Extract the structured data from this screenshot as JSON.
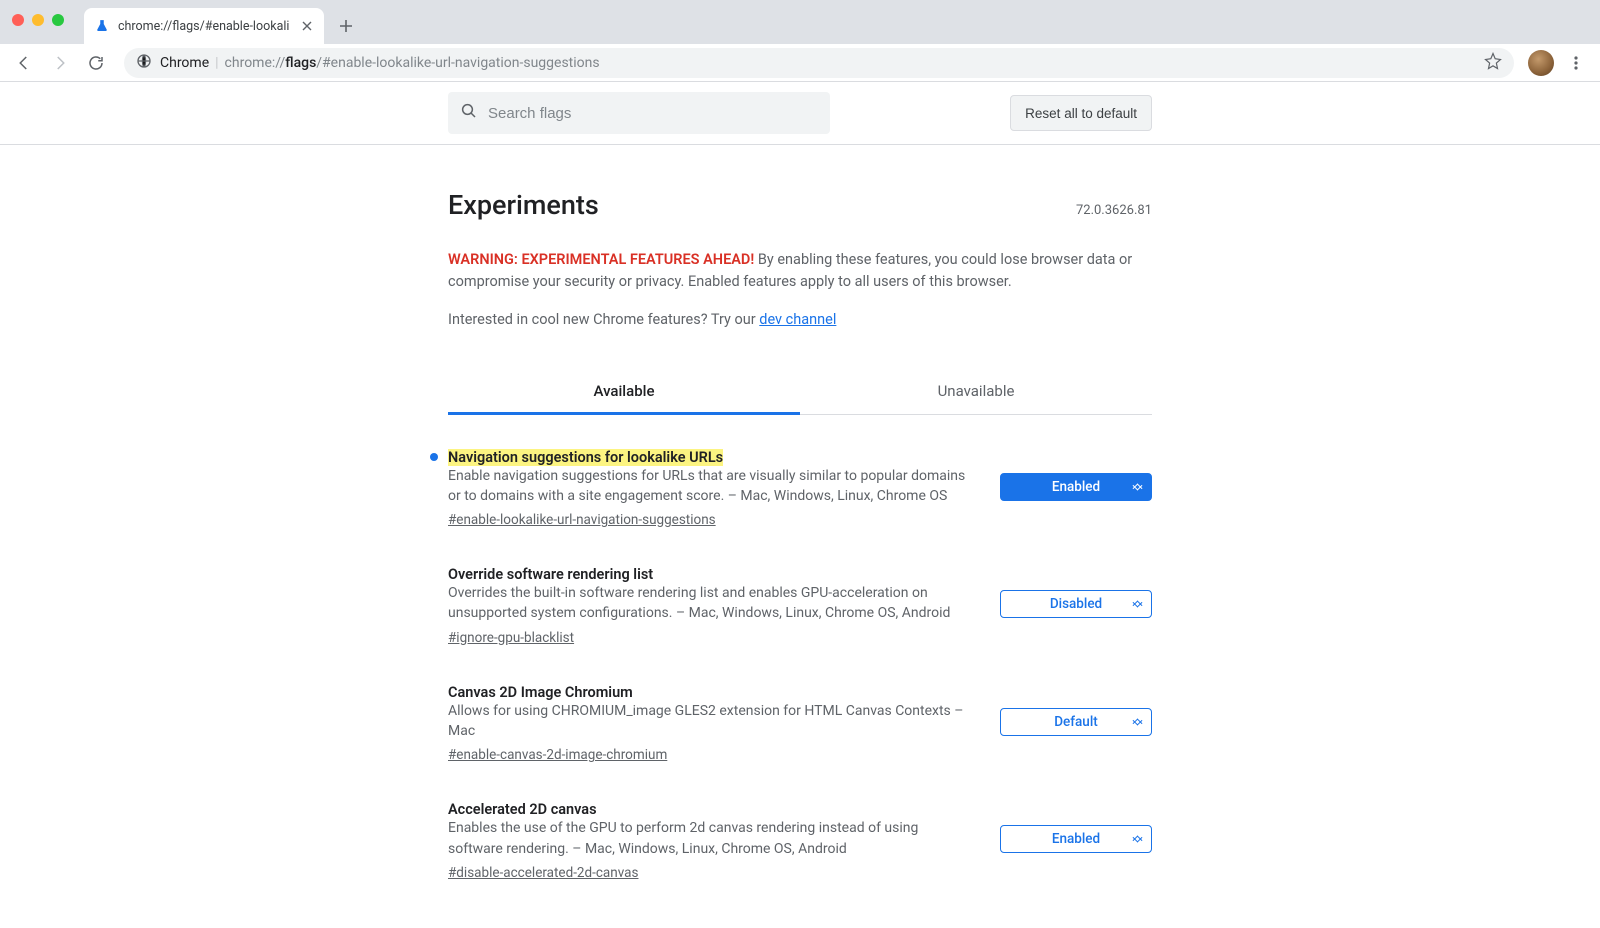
{
  "browser": {
    "tab_title": "chrome://flags/#enable-lookali",
    "url_site_label": "Chrome",
    "url_prefix": "chrome://",
    "url_bold": "flags",
    "url_rest": "/#enable-lookalike-url-navigation-suggestions"
  },
  "topbar": {
    "search_placeholder": "Search flags",
    "reset_label": "Reset all to default"
  },
  "header": {
    "title": "Experiments",
    "version": "72.0.3626.81"
  },
  "warning": {
    "bold": "WARNING: EXPERIMENTAL FEATURES AHEAD!",
    "rest": " By enabling these features, you could lose browser data or compromise your security or privacy. Enabled features apply to all users of this browser."
  },
  "interested": {
    "text": "Interested in cool new Chrome features? Try our ",
    "link": "dev channel"
  },
  "tabs": {
    "available": "Available",
    "unavailable": "Unavailable"
  },
  "flags": [
    {
      "title": "Navigation suggestions for lookalike URLs",
      "highlight": true,
      "modified": true,
      "desc": "Enable navigation suggestions for URLs that are visually similar to popular domains or to domains with a site engagement score. – Mac, Windows, Linux, Chrome OS",
      "anchor": "#enable-lookalike-url-navigation-suggestions",
      "state": "Enabled",
      "solid": true
    },
    {
      "title": "Override software rendering list",
      "highlight": false,
      "modified": false,
      "desc": "Overrides the built-in software rendering list and enables GPU-acceleration on unsupported system configurations. – Mac, Windows, Linux, Chrome OS, Android",
      "anchor": "#ignore-gpu-blacklist",
      "state": "Disabled",
      "solid": false
    },
    {
      "title": "Canvas 2D Image Chromium",
      "highlight": false,
      "modified": false,
      "desc": "Allows for using CHROMIUM_image GLES2 extension for HTML Canvas Contexts – Mac",
      "anchor": "#enable-canvas-2d-image-chromium",
      "state": "Default",
      "solid": false
    },
    {
      "title": "Accelerated 2D canvas",
      "highlight": false,
      "modified": false,
      "desc": "Enables the use of the GPU to perform 2d canvas rendering instead of using software rendering. – Mac, Windows, Linux, Chrome OS, Android",
      "anchor": "#disable-accelerated-2d-canvas",
      "state": "Enabled",
      "solid": false
    }
  ]
}
